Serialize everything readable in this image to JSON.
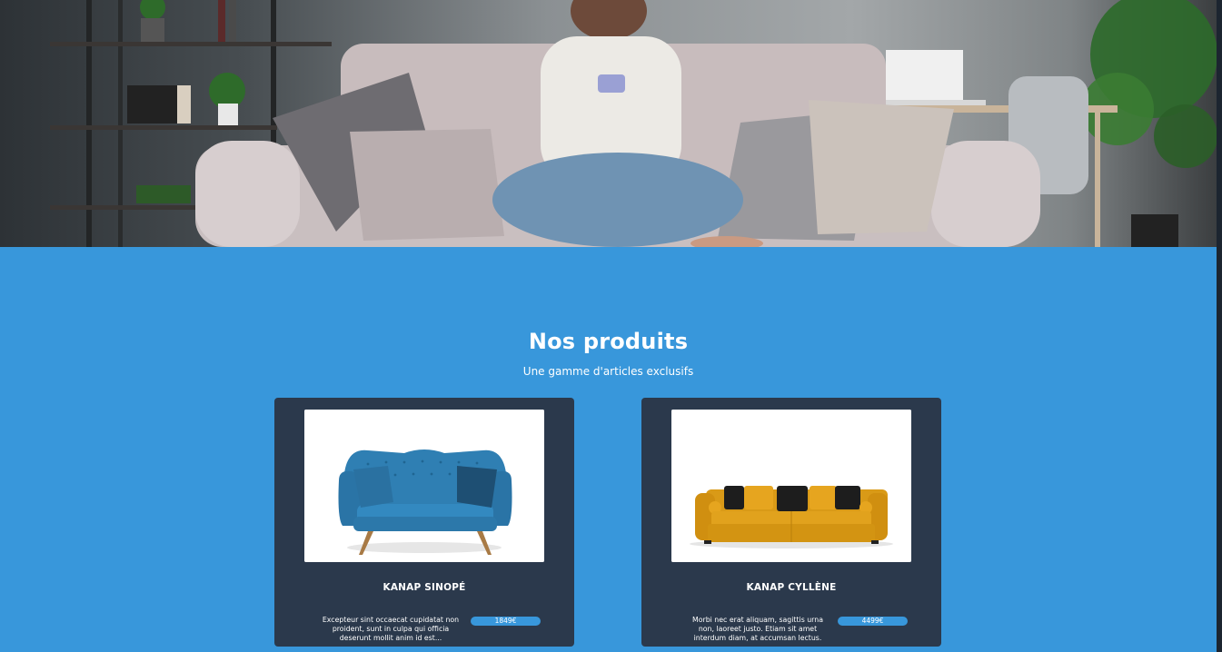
{
  "hero": {
    "image_icon": "living-room-photo"
  },
  "products": {
    "title": "Nos produits",
    "subtitle": "Une gamme d'articles exclusifs",
    "items": [
      {
        "name": "KANAP SINOPÉ",
        "description": "Excepteur sint occaecat cupidatat non proident, sunt in culpa qui officia deserunt mollit anim id est...",
        "price": "1849€",
        "color": "#2f7fb3",
        "image_icon": "blue-sofa-image"
      },
      {
        "name": "KANAP CYLLÈNE",
        "description": "Morbi nec erat aliquam, sagittis urna non, laoreet justo. Etiam sit amet interdum diam, at accumsan lectus.",
        "price": "4499€",
        "color": "#e1a21d",
        "image_icon": "yellow-sofa-image"
      }
    ]
  },
  "colors": {
    "section_bg": "#3897db",
    "card_bg": "#2b394c",
    "price_bg": "#3897db"
  }
}
